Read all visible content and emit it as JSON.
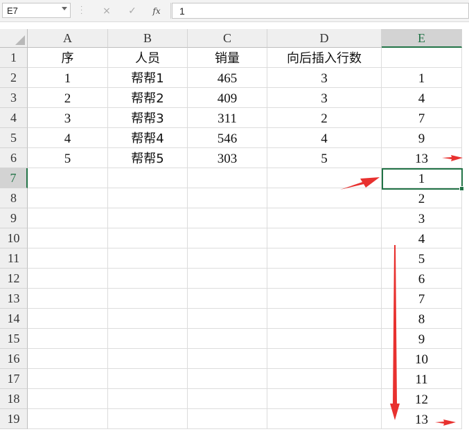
{
  "formula_bar": {
    "name_box": "E7",
    "cancel_icon": "×",
    "enter_icon": "✓",
    "fx_label": "fx",
    "content": "1"
  },
  "sheet": {
    "columns": [
      "A",
      "B",
      "C",
      "D",
      "E"
    ],
    "rows": [
      "1",
      "2",
      "3",
      "4",
      "5",
      "6",
      "7",
      "8",
      "9",
      "10",
      "11",
      "12",
      "13",
      "14",
      "15",
      "16",
      "17",
      "18",
      "19"
    ],
    "selected_cell": "E7",
    "cells": [
      [
        "序",
        "人员",
        "销量",
        "向后插入行数",
        ""
      ],
      [
        "1",
        "帮帮1",
        "465",
        "3",
        "1"
      ],
      [
        "2",
        "帮帮2",
        "409",
        "3",
        "4"
      ],
      [
        "3",
        "帮帮3",
        "311",
        "2",
        "7"
      ],
      [
        "4",
        "帮帮4",
        "546",
        "4",
        "9"
      ],
      [
        "5",
        "帮帮5",
        "303",
        "5",
        "13"
      ],
      [
        "",
        "",
        "",
        "",
        "1"
      ],
      [
        "",
        "",
        "",
        "",
        "2"
      ],
      [
        "",
        "",
        "",
        "",
        "3"
      ],
      [
        "",
        "",
        "",
        "",
        "4"
      ],
      [
        "",
        "",
        "",
        "",
        "5"
      ],
      [
        "",
        "",
        "",
        "",
        "6"
      ],
      [
        "",
        "",
        "",
        "",
        "7"
      ],
      [
        "",
        "",
        "",
        "",
        "8"
      ],
      [
        "",
        "",
        "",
        "",
        "9"
      ],
      [
        "",
        "",
        "",
        "",
        "10"
      ],
      [
        "",
        "",
        "",
        "",
        "11"
      ],
      [
        "",
        "",
        "",
        "",
        "12"
      ],
      [
        "",
        "",
        "",
        "",
        "13"
      ]
    ]
  },
  "annotation_color": "#e8312f"
}
